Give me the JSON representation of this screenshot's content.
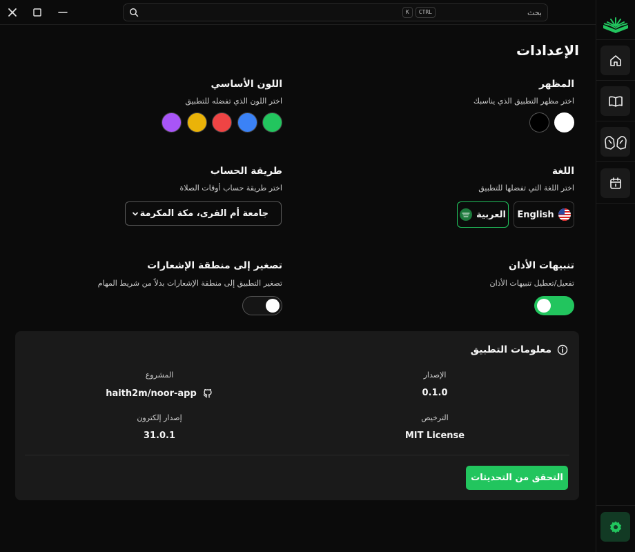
{
  "search": {
    "placeholder": "بحث",
    "kbd_ctrl": "CTRL",
    "kbd_k": "K"
  },
  "page_title": "الإعدادات",
  "appearance": {
    "title": "المظهر",
    "desc": "اختر مظهر التطبيق الذي يناسبك",
    "themes": [
      "#ffffff",
      "#000000"
    ]
  },
  "primary_color": {
    "title": "اللون الأساسي",
    "desc": "اختر اللون الذي تفضله للتطبيق",
    "colors": [
      "#22c55e",
      "#3b82f6",
      "#ef4444",
      "#eab308",
      "#a855f7"
    ]
  },
  "language": {
    "title": "اللغة",
    "desc": "اختر اللغة التي تفضلها للتطبيق",
    "english": "English",
    "arabic": "العربية",
    "selected": "العربية"
  },
  "calc_method": {
    "title": "طريقة الحساب",
    "desc": "اختر طريقة حساب أوقات الصلاة",
    "value": "جامعة أم القرى، مكة المكرمة"
  },
  "adhan": {
    "title": "تنبيهات الأذان",
    "desc": "تفعيل/تعطيل تنبيهات الأذان",
    "enabled": true
  },
  "tray": {
    "title": "تصغير إلى منطقة الإشعارات",
    "desc": "تصغير التطبيق إلى منطقة الإشعارات بدلاً من شريط المهام",
    "enabled": false
  },
  "app_info": {
    "title": "معلومات التطبيق",
    "version_label": "الإصدار",
    "version": "0.1.0",
    "license_label": "الترخيص",
    "license": "MIT License",
    "project_label": "المشروع",
    "project": "haith2m/noor-app",
    "electron_label": "إصدار إلكترون",
    "electron": "31.0.1",
    "update_button": "التحقق من التحديثات"
  },
  "accent": "#22c55e"
}
